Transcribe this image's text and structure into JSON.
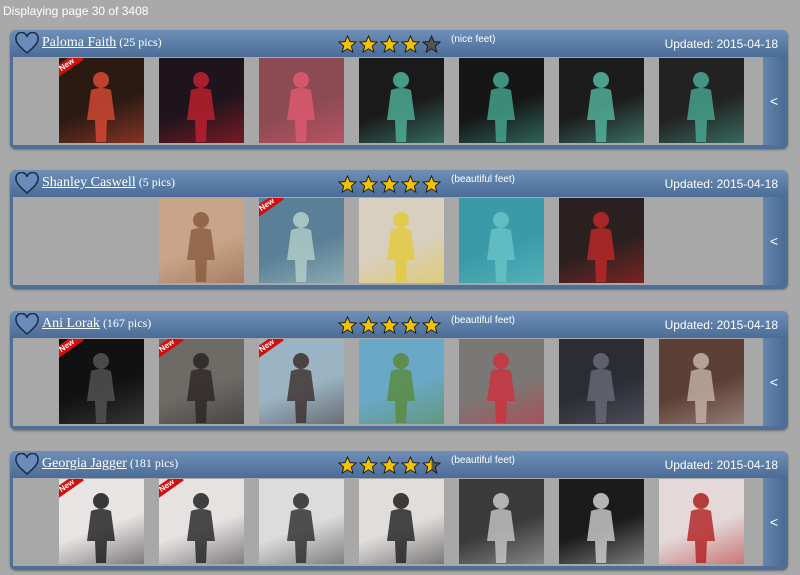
{
  "pagination": {
    "text": "Displaying page 30 of 3408"
  },
  "colors": {
    "header": "#5b7ca6",
    "star_fill": "#f4c300",
    "new_badge": "#d40d0d"
  },
  "scroll_icon": "chevron-left-icon",
  "cards": [
    {
      "name": "Paloma Faith",
      "pics": "(25 pics)",
      "rating": 4,
      "feet": "(nice feet)",
      "updated": "Updated: 2015-04-18",
      "thumbs": [
        {
          "new": true,
          "bg": "#2a1a12",
          "accent": "#d94a36"
        },
        {
          "new": false,
          "bg": "#20141c",
          "accent": "#c22030"
        },
        {
          "new": false,
          "bg": "#8c4a52",
          "accent": "#e05a70"
        },
        {
          "new": false,
          "bg": "#1a1a1a",
          "accent": "#4fb39b"
        },
        {
          "new": false,
          "bg": "#161616",
          "accent": "#46a890"
        },
        {
          "new": false,
          "bg": "#1c1c1c",
          "accent": "#55b8a0"
        },
        {
          "new": false,
          "bg": "#222",
          "accent": "#4aa994"
        }
      ]
    },
    {
      "name": "Shanley Caswell",
      "pics": "(5 pics)",
      "rating": 5,
      "feet": "(beautiful feet)",
      "updated": "Updated: 2015-04-18",
      "thumbs": [
        {
          "new": false,
          "offset": 1,
          "bg": "#c8a58a",
          "accent": "#8a5b40"
        },
        {
          "new": true,
          "offset": 1,
          "bg": "#5a7f96",
          "accent": "#b4d0c9"
        },
        {
          "new": false,
          "offset": 1,
          "bg": "#d8cfbf",
          "accent": "#e3c93a"
        },
        {
          "new": false,
          "offset": 1,
          "bg": "#3a9aa8",
          "accent": "#6ac4c8"
        },
        {
          "new": false,
          "offset": 1,
          "bg": "#2a2020",
          "accent": "#c02828"
        }
      ]
    },
    {
      "name": "Ani Lorak",
      "pics": "(167 pics)",
      "rating": 5,
      "feet": "(beautiful feet)",
      "updated": "Updated: 2015-04-18",
      "thumbs": [
        {
          "new": true,
          "bg": "#111",
          "accent": "#555"
        },
        {
          "new": true,
          "bg": "#6e6a66",
          "accent": "#2a2523"
        },
        {
          "new": true,
          "bg": "#9bb4c4",
          "accent": "#3d2e2c"
        },
        {
          "new": false,
          "bg": "#6aa8c8",
          "accent": "#5a8a3a"
        },
        {
          "new": false,
          "bg": "#7a7876",
          "accent": "#d0303c"
        },
        {
          "new": false,
          "bg": "#2c2c34",
          "accent": "#6a6a78"
        },
        {
          "new": false,
          "bg": "#5c4036",
          "accent": "#c6b3a8"
        }
      ]
    },
    {
      "name": "Georgia Jagger",
      "pics": "(181 pics)",
      "rating": 4.5,
      "feet": "(beautiful feet)",
      "updated": "Updated: 2015-04-18",
      "thumbs": [
        {
          "new": true,
          "bg": "#e8e4e4",
          "accent": "#1a1a1a"
        },
        {
          "new": true,
          "bg": "#e6e2e2",
          "accent": "#222"
        },
        {
          "new": false,
          "bg": "#dcdcdc",
          "accent": "#2a2a2a"
        },
        {
          "new": false,
          "bg": "#e0dddb",
          "accent": "#1e1e1e"
        },
        {
          "new": false,
          "bg": "#3a3a3a",
          "accent": "#c8c8c8"
        },
        {
          "new": false,
          "bg": "#1b1b1b",
          "accent": "#cfcfcf"
        },
        {
          "new": false,
          "bg": "#e4d8d8",
          "accent": "#b02020"
        }
      ]
    }
  ]
}
